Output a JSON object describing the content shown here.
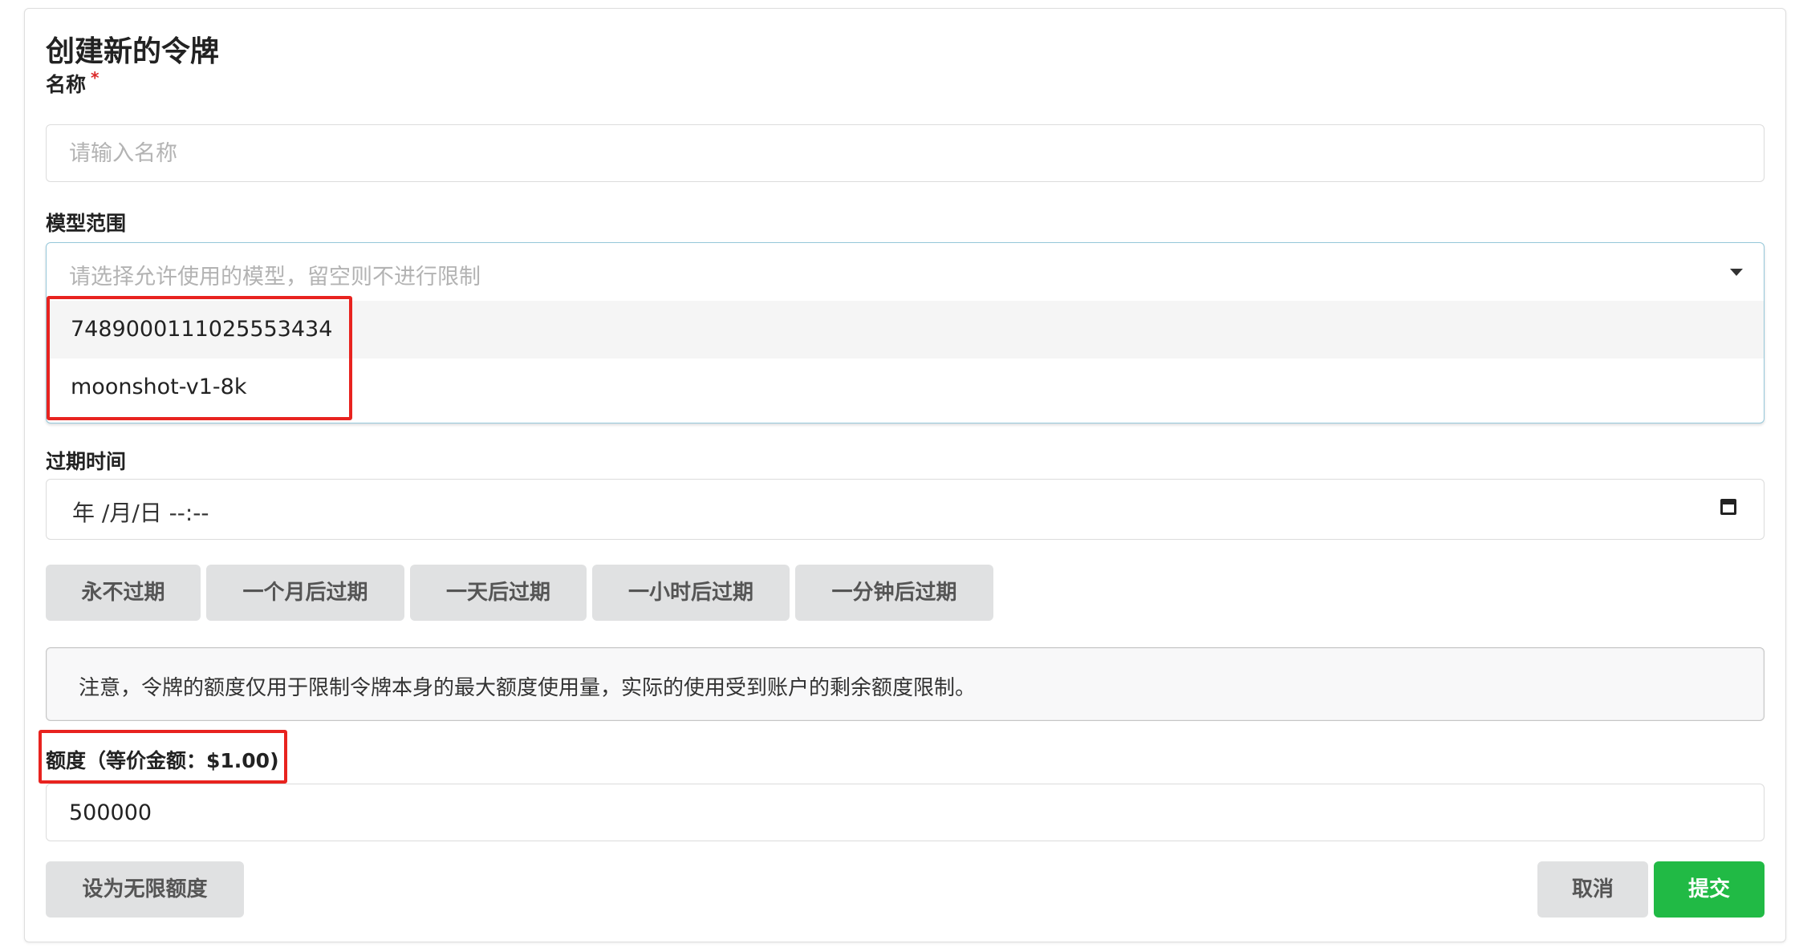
{
  "form": {
    "title": "创建新的令牌",
    "name": {
      "label": "名称",
      "required_mark": "*",
      "placeholder": "请输入名称",
      "value": ""
    },
    "models": {
      "label": "模型范围",
      "placeholder": "请选择允许使用的模型，留空则不进行限制",
      "options": [
        "7489000111025553434",
        "moonshot-v1-8k"
      ]
    },
    "expiry": {
      "label": "过期时间",
      "value": "年 /月/日 --:--",
      "quick_buttons": [
        "永不过期",
        "一个月后过期",
        "一天后过期",
        "一小时后过期",
        "一分钟后过期"
      ]
    },
    "notice": "注意，令牌的额度仅用于限制令牌本身的最大额度使用量，实际的使用受到账户的剩余额度限制。",
    "quota": {
      "label": "额度（等价金额：$1.00)",
      "value": "500000"
    },
    "buttons": {
      "unlimited": "设为无限额度",
      "cancel": "取消",
      "submit": "提交"
    }
  },
  "colors": {
    "submit_green": "#21ba45",
    "button_gray": "#e0e1e2",
    "annotation_red": "#e8231f",
    "dropdown_border": "#96c8da"
  },
  "icons": {
    "dropdown": "chevron-down-icon",
    "date_picker": "calendar-icon"
  }
}
